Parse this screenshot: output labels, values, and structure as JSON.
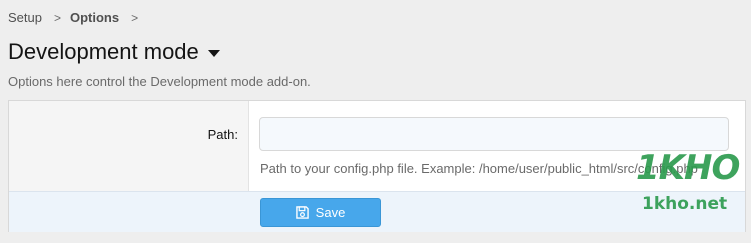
{
  "breadcrumb": {
    "items": [
      "Setup",
      "Options"
    ],
    "separator": ">"
  },
  "page": {
    "title": "Development mode",
    "description": "Options here control the Development mode add-on."
  },
  "form": {
    "path_label": "Path:",
    "path_value": "",
    "path_hint": "Path to your config.php file. Example: /home/user/public_html/src/config.php"
  },
  "actions": {
    "save_label": "Save",
    "save_icon": "save-icon"
  },
  "watermark": {
    "logo": "1KHO",
    "site": "1kho.net"
  },
  "colors": {
    "accent": "#47a7eb",
    "watermark": "#2a9a4c"
  }
}
